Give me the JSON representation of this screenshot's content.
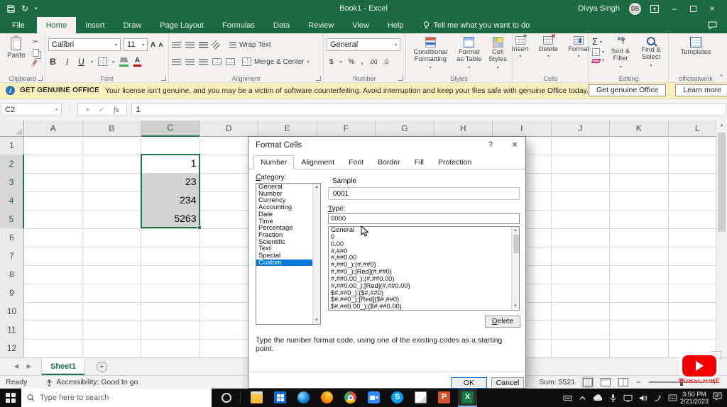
{
  "titlebar": {
    "title": "Book1 - Excel",
    "user_name": "Divya Singh",
    "user_initials": "DS"
  },
  "menu": {
    "file": "File",
    "tabs": [
      "Home",
      "Insert",
      "Draw",
      "Page Layout",
      "Formulas",
      "Data",
      "Review",
      "View",
      "Help"
    ],
    "active_tab": "Home",
    "tell_me": "Tell me what you want to do"
  },
  "ribbon": {
    "clipboard": {
      "label": "Clipboard",
      "paste": "Paste"
    },
    "font": {
      "label": "Font",
      "family": "Calibri",
      "size": "11"
    },
    "alignment": {
      "label": "Alignment",
      "wrap_text": "Wrap Text",
      "merge_center": "Merge & Center"
    },
    "number": {
      "label": "Number",
      "format": "General"
    },
    "styles": {
      "label": "Styles",
      "conditional": "Conditional Formatting",
      "format_table": "Format as Table",
      "cell_styles": "Cell Styles"
    },
    "cells": {
      "label": "Cells",
      "insert": "Insert",
      "delete": "Delete",
      "format": "Format"
    },
    "editing": {
      "label": "Editing",
      "sort_filter": "Sort & Filter",
      "find_select": "Find & Select"
    },
    "officeatwork": {
      "label": "officeatwork",
      "templates": "Templates"
    }
  },
  "warning_bar": {
    "title": "GET GENUINE OFFICE",
    "message": "Your license isn't genuine, and you may be a victim of software counterfeiting. Avoid interruption and keep your files safe with genuine Office today.",
    "get_button": "Get genuine Office",
    "learn_button": "Learn more"
  },
  "formula_bar": {
    "name_box": "C2",
    "value": "1"
  },
  "grid": {
    "columns": [
      "A",
      "B",
      "C",
      "D",
      "E",
      "F",
      "G",
      "H",
      "I",
      "J",
      "K",
      "L"
    ],
    "row_count": 12,
    "selection": {
      "column": "C",
      "rows_start": 2,
      "rows_end": 5,
      "active_cell": "C2"
    },
    "cells": {
      "C2": "1",
      "C3": "23",
      "C4": "234",
      "C5": "5263"
    }
  },
  "dialog": {
    "title": "Format Cells",
    "tabs": [
      "Number",
      "Alignment",
      "Font",
      "Border",
      "Fill",
      "Protection"
    ],
    "active_tab": "Number",
    "category_label": "Category:",
    "categories": [
      "General",
      "Number",
      "Currency",
      "Accounting",
      "Date",
      "Time",
      "Percentage",
      "Fraction",
      "Scientific",
      "Text",
      "Special",
      "Custom"
    ],
    "selected_category": "Custom",
    "sample_label": "Sample",
    "sample_value": "0001",
    "type_label": "Type:",
    "type_value": "0000",
    "format_codes": [
      "General",
      "0",
      "0.00",
      "#,##0",
      "#,##0.00",
      "#,##0_);(#,##0)",
      "#,##0_);[Red](#,##0)",
      "#,##0.00_);(#,##0.00)",
      "#,##0.00_);[Red](#,##0.00)",
      "$#,##0_);($#,##0)",
      "$#,##0_);[Red]($#,##0)",
      "$#,##0.00_);($#,##0.00)"
    ],
    "delete_button": "Delete",
    "help_text": "Type the number format code, using one of the existing codes as a starting point.",
    "ok_button": "OK",
    "cancel_button": "Cancel"
  },
  "sheet_bar": {
    "sheet_name": "Sheet1"
  },
  "status_bar": {
    "ready": "Ready",
    "accessibility": "Accessibility: Good to go",
    "sum": "Sum: 5521"
  },
  "taskbar": {
    "search_placeholder": "Type here to search",
    "apps": [
      "file-explorer",
      "store",
      "edge",
      "firefox",
      "chrome",
      "zoom",
      "skype",
      "sticky-notes",
      "powerpoint",
      "excel"
    ],
    "active_app": "excel",
    "tray": [
      "pen-input",
      "hidden-icons",
      "onedrive",
      "microphone",
      "display",
      "volume",
      "dongle",
      "touch-keyboard"
    ],
    "time": "3:50 PM",
    "date": "2/21/2023"
  },
  "overlay": {
    "subscribe": "SUBSCRIBE"
  },
  "icons": {
    "cut": "✂",
    "bold": "B",
    "italic": "I",
    "underline": "U",
    "autosum": "Σ",
    "dollar": "$",
    "percent": "%",
    "comma": ",",
    "increase_decimal": ".00",
    "decrease_decimal": ".0",
    "redo": "↻",
    "dropdown": "▾",
    "close": "×",
    "minimize": "–",
    "help": "?",
    "scroll_up": "▲",
    "scroll_down": "▼",
    "nav_left": "◄",
    "nav_right": "►",
    "add_sheet": "+",
    "chevron_up": "^",
    "check": "✓",
    "cancel_x": "×",
    "info": "i",
    "fx": "fx",
    "grip": "⋮",
    "font_grow": "A",
    "font_shrink": "A",
    "fill_down": "↓",
    "az": "AZ"
  },
  "colors": {
    "excel_green": "#1d6a42",
    "selection_green": "#217346",
    "accent_blue": "#0078d7",
    "warning_yellow": "#fbf0bb"
  }
}
